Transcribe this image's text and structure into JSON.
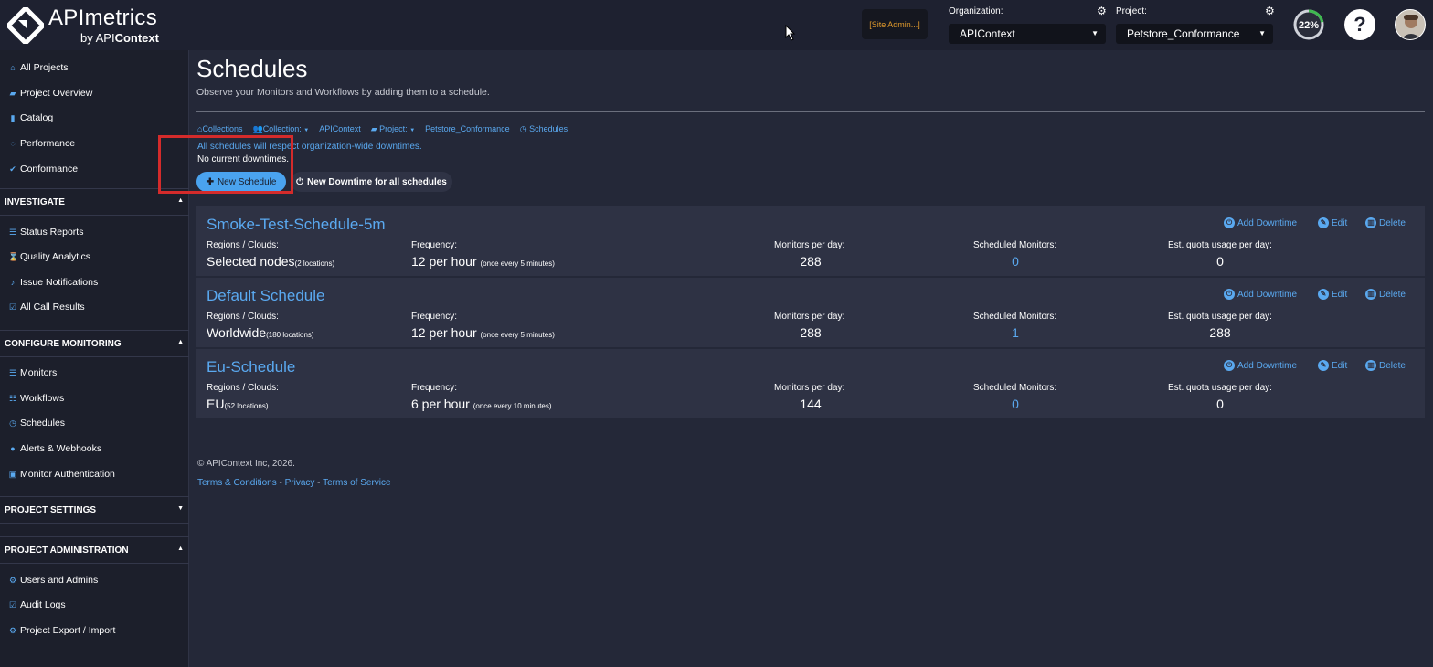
{
  "header": {
    "brand": "APImetrics",
    "brand_sub_prefix": "by API",
    "brand_sub_bold": "Context",
    "site_admin": "[Site Admin...]",
    "org_label": "Organization:",
    "org_value": "APIContext",
    "project_label": "Project:",
    "project_value": "Petstore_Conformance",
    "quota_percent": "22%",
    "quota_fraction": 0.22,
    "help": "?"
  },
  "sidebar": {
    "top_items": [
      {
        "label": "All Projects",
        "icon": "home-icon"
      },
      {
        "label": "Project Overview",
        "icon": "folder-icon"
      },
      {
        "label": "Catalog",
        "icon": "book-icon"
      },
      {
        "label": "Performance",
        "icon": "gauge-icon"
      },
      {
        "label": "Conformance",
        "icon": "check-icon"
      }
    ],
    "investigate": {
      "title": "INVESTIGATE",
      "items": [
        {
          "label": "Status Reports",
          "icon": "list-icon"
        },
        {
          "label": "Quality Analytics",
          "icon": "hourglass-icon"
        },
        {
          "label": "Issue Notifications",
          "icon": "bell-icon"
        },
        {
          "label": "All Call Results",
          "icon": "check-square-icon"
        }
      ]
    },
    "configure": {
      "title": "CONFIGURE MONITORING",
      "items": [
        {
          "label": "Monitors",
          "icon": "list-icon"
        },
        {
          "label": "Workflows",
          "icon": "flow-icon"
        },
        {
          "label": "Schedules",
          "icon": "clock-icon"
        },
        {
          "label": "Alerts & Webhooks",
          "icon": "globe-icon"
        },
        {
          "label": "Monitor Authentication",
          "icon": "lock-icon"
        }
      ]
    },
    "settings": {
      "title": "PROJECT SETTINGS"
    },
    "admin": {
      "title": "PROJECT ADMINISTRATION",
      "items": [
        {
          "label": "Users and Admins",
          "icon": "gear-icon"
        },
        {
          "label": "Audit Logs",
          "icon": "check-square-icon"
        },
        {
          "label": "Project Export / Import",
          "icon": "gear-icon"
        }
      ]
    }
  },
  "main": {
    "title": "Schedules",
    "subtitle": "Observe your Monitors and Workflows by adding them to a schedule.",
    "breadcrumbs": {
      "collections": "Collections",
      "collection_label": "Collection:",
      "collection_value": "APIContext",
      "project_label": "Project:",
      "project_value": "Petstore_Conformance",
      "schedules": "Schedules"
    },
    "notice": "All schedules will respect organization-wide downtimes.",
    "no_downtimes": "No current downtimes.",
    "new_schedule": "New Schedule",
    "new_downtime_all": "New Downtime for all schedules"
  },
  "labels": {
    "regions": "Regions / Clouds:",
    "frequency": "Frequency:",
    "monitors_per_day": "Monitors per day:",
    "scheduled_monitors": "Scheduled Monitors:",
    "quota": "Est. quota usage per day:",
    "add_downtime": "Add Downtime",
    "edit": "Edit",
    "delete": "Delete"
  },
  "schedules": [
    {
      "name": "Smoke-Test-Schedule-5m",
      "region": "Selected nodes",
      "region_count": "(2 locations)",
      "frequency": "12 per hour",
      "frequency_detail": "(once every 5 minutes)",
      "monitors_per_day": "288",
      "scheduled_monitors": "0",
      "quota": "0"
    },
    {
      "name": "Default Schedule",
      "region": "Worldwide",
      "region_count": "(180 locations)",
      "frequency": "12 per hour",
      "frequency_detail": "(once every 5 minutes)",
      "monitors_per_day": "288",
      "scheduled_monitors": "1",
      "quota": "288"
    },
    {
      "name": "Eu-Schedule",
      "region": "EU",
      "region_count": "(52 locations)",
      "frequency": "6 per hour",
      "frequency_detail": "(once every 10 minutes)",
      "monitors_per_day": "144",
      "scheduled_monitors": "0",
      "quota": "0"
    }
  ],
  "footer": {
    "copyright": "© APIContext Inc, 2026.",
    "terms": "Terms & Conditions",
    "sep": " - ",
    "privacy": "Privacy",
    "tos": "Terms of Service"
  }
}
